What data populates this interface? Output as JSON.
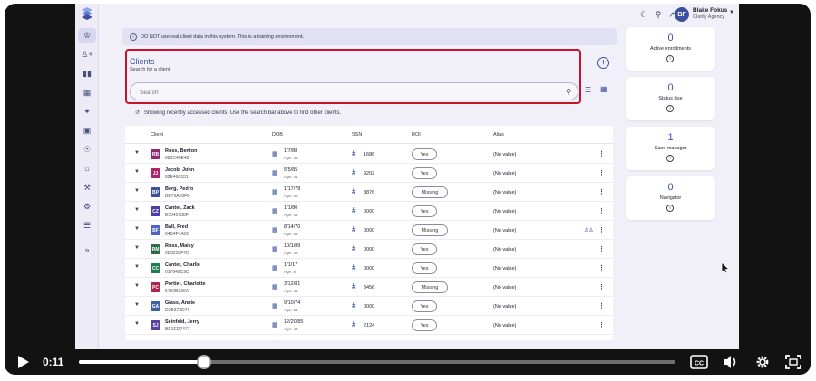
{
  "banner": {
    "text": "DO NOT use real client data in this system. This is a training environment."
  },
  "user": {
    "initials": "BF",
    "name": "Blake Fokus",
    "org": "Clarity Agency"
  },
  "clients": {
    "title": "Clients",
    "subtitle": "Search for a client",
    "search_placeholder": "Search",
    "notice": "Showing recently accessed clients. Use the search bar above to find other clients."
  },
  "table": {
    "headers": {
      "client": "Client",
      "dob": "DOB",
      "ssn": "SSN",
      "roi": "ROI",
      "alias": "Alias"
    },
    "rows": [
      {
        "initials": "RB",
        "color": "#8e2a6e",
        "name": "Ross, Benton",
        "id": "680C40E48",
        "dob": "1/7/88",
        "age": "Age: 38",
        "ssn": "1686",
        "roi": "Yes",
        "alias": "(No value)"
      },
      {
        "initials": "JJ",
        "color": "#b0246a",
        "name": "Jacob, John",
        "id": "82E460331",
        "dob": "5/5/85",
        "age": "Age: 41",
        "ssn": "9202",
        "roi": "Yes",
        "alias": "(No value)"
      },
      {
        "initials": "BP",
        "color": "#3d4f9e",
        "name": "Berg, Pedro",
        "id": "BE79A26FD",
        "dob": "1/17/78",
        "age": "Age: 48",
        "ssn": "8876",
        "roi": "Missing",
        "alias": "(No value)"
      },
      {
        "initials": "CZ",
        "color": "#4a3fa6",
        "name": "Canter, Zack",
        "id": "E5545188F",
        "dob": "1/1/80",
        "age": "Age: 46",
        "ssn": "0000",
        "roi": "Yes",
        "alias": "(No value)"
      },
      {
        "initials": "BF",
        "color": "#4d63c9",
        "name": "Ball, Fred",
        "id": "04B4F1A0C",
        "dob": "8/14/70",
        "age": "Age: 55",
        "ssn": "0000",
        "roi": "Missing",
        "alias": "(No value)",
        "group": true
      },
      {
        "initials": "RM",
        "color": "#2f6b4a",
        "name": "Ross, Maisy",
        "id": "0B8230F7D",
        "dob": "10/1/89",
        "age": "Age: 36",
        "ssn": "0000",
        "roi": "Yes",
        "alias": "(No value)"
      },
      {
        "initials": "CC",
        "color": "#1f7a4d",
        "name": "Canter, Charlie",
        "id": "017642C9D",
        "dob": "1/1/17",
        "age": "Age: 9",
        "ssn": "0000",
        "roi": "Yes",
        "alias": "(No value)"
      },
      {
        "initials": "PC",
        "color": "#b0244a",
        "name": "Portier, Charlotte",
        "id": "5730B396A",
        "dob": "3/12/81",
        "age": "Age: 45",
        "ssn": "3456",
        "roi": "Missing",
        "alias": "(No value)"
      },
      {
        "initials": "GA",
        "color": "#3d5fa8",
        "name": "Glass, Annie",
        "id": "D2B373D79",
        "dob": "9/10/74",
        "age": "Age: 51",
        "ssn": "0000",
        "roi": "Yes",
        "alias": "(No value)"
      },
      {
        "initials": "SJ",
        "color": "#5a3fa6",
        "name": "Seinfeld, Jerry",
        "id": "BE1ED7477",
        "dob": "12/20/85",
        "age": "Age: 40",
        "ssn": "2124",
        "roi": "Yes",
        "alias": "(No value)"
      }
    ]
  },
  "cards": [
    {
      "value": "0",
      "label": "Active enrollments"
    },
    {
      "value": "0",
      "label": "Status due"
    },
    {
      "value": "1",
      "label": "Case manager"
    },
    {
      "value": "0",
      "label": "Navigator"
    }
  ],
  "player": {
    "time": "0:11",
    "progress": 0.21,
    "cc_label": "CC"
  },
  "icons": {
    "sidebar": [
      "clients-icon",
      "add-person-icon",
      "bar-chart-icon",
      "calendar-icon",
      "wand-icon",
      "calendar-check-icon",
      "location-icon",
      "house-icon",
      "wrench-icon",
      "settings-icon",
      "list-icon",
      "expand-icon"
    ]
  },
  "colors": {
    "accent": "#3d4f9e",
    "highlight": "#c8122e",
    "background": "#f1f0f8"
  }
}
